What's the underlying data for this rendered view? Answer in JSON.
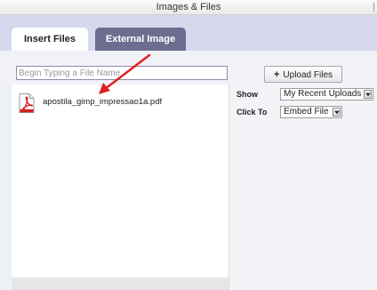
{
  "window": {
    "title": "Images & Files"
  },
  "tabs": [
    {
      "label": "Insert Files",
      "active": true
    },
    {
      "label": "External Image",
      "active": false
    }
  ],
  "search": {
    "placeholder": "Begin Typing a File Name",
    "value": ""
  },
  "upload_button": {
    "label": "Upload Files",
    "icon": "plus-icon"
  },
  "files": [
    {
      "name": "apostila_gimp_impressao1a.pdf",
      "icon": "pdf-icon"
    }
  ],
  "options": {
    "show": {
      "label": "Show",
      "value": "My Recent Uploads"
    },
    "click_to": {
      "label": "Click To",
      "value": "Embed File"
    }
  },
  "annotation": {
    "type": "arrow",
    "color": "#e02020"
  },
  "colors": {
    "tab_strip": "#d6d9ee",
    "inactive_tab": "#6d6d90",
    "pdf_red": "#d42020"
  }
}
